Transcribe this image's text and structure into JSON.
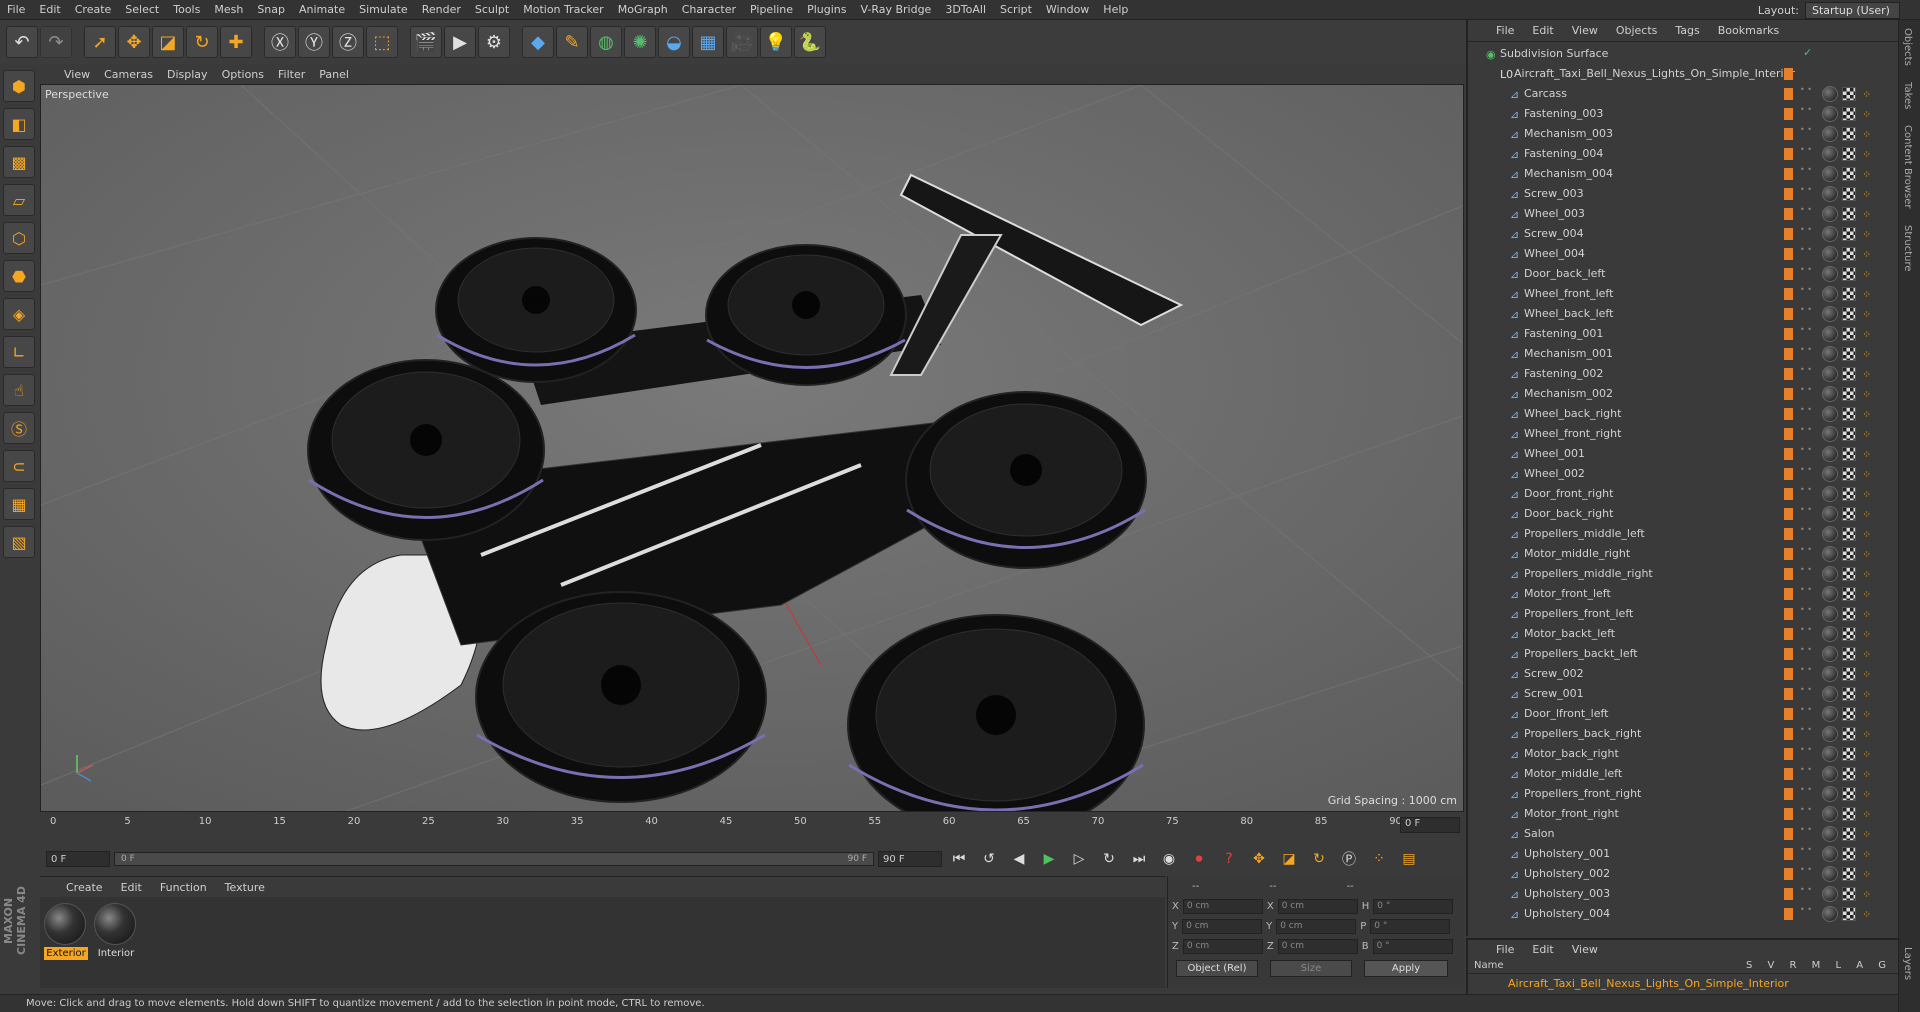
{
  "menubar": {
    "items": [
      "File",
      "Edit",
      "Create",
      "Select",
      "Tools",
      "Mesh",
      "Snap",
      "Animate",
      "Simulate",
      "Render",
      "Sculpt",
      "Motion Tracker",
      "MoGraph",
      "Character",
      "Pipeline",
      "Plugins",
      "V-Ray Bridge",
      "3DToAll",
      "Script",
      "Window",
      "Help"
    ],
    "layout_label": "Layout:",
    "layout_value": "Startup (User)"
  },
  "toolbar": {
    "icons": [
      "undo-icon",
      "redo-icon",
      "select-icon",
      "move-icon",
      "scale-icon",
      "rotate-icon",
      "add-icon",
      "x-axis-icon",
      "y-axis-icon",
      "z-axis-icon",
      "coord-system-icon",
      "render-view-icon",
      "render-picture-viewer-icon",
      "render-settings-icon",
      "cube-icon",
      "pen-icon",
      "subdivide-icon",
      "array-icon",
      "deformer-icon",
      "floor-icon",
      "camera-icon",
      "light-icon",
      "python-icon"
    ]
  },
  "viewport": {
    "menu": [
      "View",
      "Cameras",
      "Display",
      "Options",
      "Filter",
      "Panel"
    ],
    "label": "Perspective",
    "grid_spacing": "Grid Spacing : 1000 cm"
  },
  "timeline": {
    "ticks": [
      "0",
      "5",
      "10",
      "15",
      "20",
      "25",
      "30",
      "35",
      "40",
      "45",
      "50",
      "55",
      "60",
      "65",
      "70",
      "75",
      "80",
      "85",
      "90"
    ],
    "current_frame": "0 F"
  },
  "transport": {
    "start_field": "0 F",
    "slider_left": "0 F",
    "slider_right": "90 F",
    "end_field": "90 F"
  },
  "materials": {
    "menu": [
      "Create",
      "Edit",
      "Function",
      "Texture"
    ],
    "items": [
      {
        "name": "Exterior",
        "selected": true
      },
      {
        "name": "Interior",
        "selected": false
      }
    ]
  },
  "coords": {
    "header": [
      "--",
      "--",
      "--"
    ],
    "rows": [
      {
        "a": "X",
        "av": "0 cm",
        "b": "X",
        "bv": "0 cm",
        "c": "H",
        "cv": "0 °"
      },
      {
        "a": "Y",
        "av": "0 cm",
        "b": "Y",
        "bv": "0 cm",
        "c": "P",
        "cv": "0 °"
      },
      {
        "a": "Z",
        "av": "0 cm",
        "b": "Z",
        "bv": "0 cm",
        "c": "B",
        "cv": "0 °"
      }
    ],
    "mode": "Object (Rel)",
    "size_mode": "Size",
    "apply_label": "Apply"
  },
  "status": "Move: Click and drag to move elements. Hold down SHIFT to quantize movement / add to the selection in point mode, CTRL to remove.",
  "object_manager": {
    "menu": [
      "File",
      "Edit",
      "View",
      "Objects",
      "Tags",
      "Bookmarks"
    ],
    "root": "Subdivision Surface",
    "group": "Aircraft_Taxi_Bell_Nexus_Lights_On_Simple_Interior",
    "objects": [
      "Carcass",
      "Fastening_003",
      "Mechanism_003",
      "Fastening_004",
      "Mechanism_004",
      "Screw_003",
      "Wheel_003",
      "Screw_004",
      "Wheel_004",
      "Door_back_left",
      "Wheel_front_left",
      "Wheel_back_left",
      "Fastening_001",
      "Mechanism_001",
      "Fastening_002",
      "Mechanism_002",
      "Wheel_back_right",
      "Wheel_front_right",
      "Wheel_001",
      "Wheel_002",
      "Door_front_right",
      "Door_back_right",
      "Propellers_middle_left",
      "Motor_middle_right",
      "Propellers_middle_right",
      "Motor_front_left",
      "Propellers_front_left",
      "Motor_backt_left",
      "Propellers_backt_left",
      "Screw_002",
      "Screw_001",
      "Door_lfront_left",
      "Propellers_back_right",
      "Motor_back_right",
      "Motor_middle_left",
      "Propellers_front_right",
      "Motor_front_right",
      "Salon",
      "Upholstery_001",
      "Upholstery_002",
      "Upholstery_003",
      "Upholstery_004"
    ]
  },
  "side_tabs": [
    "Objects",
    "Takes",
    "Content Browser",
    "Structure"
  ],
  "layer_manager": {
    "menu": [
      "File",
      "Edit",
      "View"
    ],
    "columns_name": "Name",
    "columns_flags": [
      "S",
      "V",
      "R",
      "M",
      "L",
      "A",
      "G"
    ],
    "row": "Aircraft_Taxi_Bell_Nexus_Lights_On_Simple_Interior",
    "side_tab": "Layers"
  },
  "brand": "MAXON CINEMA 4D"
}
